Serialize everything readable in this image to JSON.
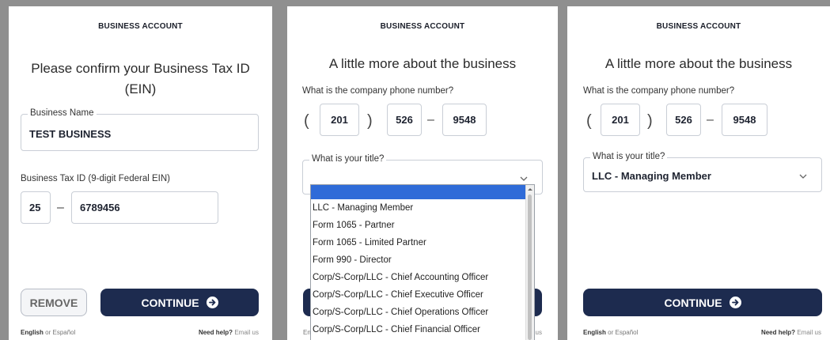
{
  "panel1": {
    "heading": "BUSINESS ACCOUNT",
    "title_line1": "Please confirm your Business Tax ID",
    "title_line2": "(EIN)",
    "business_name_label": "Business Name",
    "business_name_value": "TEST BUSINESS",
    "ein_label": "Business Tax ID (9-digit Federal EIN)",
    "ein_prefix": "25",
    "ein_separator": "–",
    "ein_suffix": "6789456",
    "remove_label": "REMOVE",
    "continue_label": "CONTINUE",
    "lang_english": "English",
    "lang_or": "or",
    "lang_spanish": "Español",
    "help_text": "Need help?",
    "help_link": "Email us"
  },
  "panel2": {
    "heading": "BUSINESS ACCOUNT",
    "title": "A little more about the business",
    "phone_label": "What is the company phone number?",
    "open_paren": "(",
    "close_paren": ")",
    "area_code": "201",
    "prefix": "526",
    "dash": "–",
    "line_number": "9548",
    "title_label": "What is your title?",
    "title_value": "",
    "options": [
      "LLC - Managing Member",
      "Form 1065 - Partner",
      "Form 1065 - Limited Partner",
      "Form 990 - Director",
      "Corp/S-Corp/LLC - Chief Accounting Officer",
      "Corp/S-Corp/LLC - Chief Executive Officer",
      "Corp/S-Corp/LLC - Chief Operations Officer",
      "Corp/S-Corp/LLC - Chief Financial Officer"
    ],
    "footer_left_fragment": "En",
    "footer_right_fragment": "us"
  },
  "panel3": {
    "heading": "BUSINESS ACCOUNT",
    "title": "A little more about the business",
    "phone_label": "What is the company phone number?",
    "open_paren": "(",
    "close_paren": ")",
    "area_code": "201",
    "prefix": "526",
    "dash": "–",
    "line_number": "9548",
    "title_label": "What is your title?",
    "title_value": "LLC - Managing Member",
    "continue_label": "CONTINUE",
    "lang_english": "English",
    "lang_or": "or",
    "lang_spanish": "Español",
    "help_text": "Need help?",
    "help_link": "Email us"
  },
  "colors": {
    "primary_button": "#1d2b4f",
    "selected_option": "#2f6bd8",
    "backdrop": "#8f8f8f"
  },
  "icons": {
    "continue_icon": "arrow-right-circle-icon",
    "select_icon": "chevron-down-icon"
  }
}
